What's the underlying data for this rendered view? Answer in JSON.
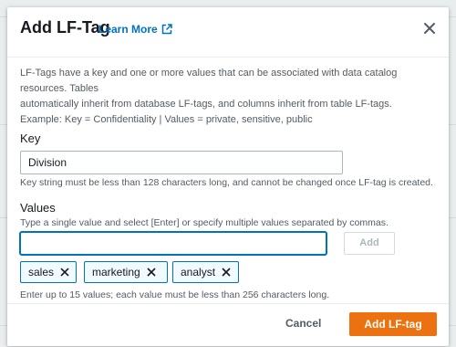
{
  "colors": {
    "primary": "#ec7211",
    "link": "#0073bb",
    "text": "#16191f",
    "muted": "#545b64"
  },
  "modal": {
    "title": "Add LF-Tag",
    "learn_more": "Learn More",
    "learn_more_icon": "external-link-icon",
    "close_icon": "close-icon"
  },
  "description": {
    "line1": "LF-Tags have a key and one or more values that can be associated with data catalog resources. Tables",
    "line2": "automatically inherit from database LF-tags, and columns inherit from table LF-tags.",
    "example": "Example: Key = Confidentiality | Values = private, sensitive, public"
  },
  "key": {
    "label": "Key",
    "value": "Division",
    "hint": "Key string must be less than 128 characters long, and cannot be changed once LF-tag is created."
  },
  "values": {
    "label": "Values",
    "description": "Type a single value and select [Enter] or specify multiple values separated by commas.",
    "input_value": "",
    "add_label": "Add",
    "tags": [
      "sales",
      "marketing",
      "analyst"
    ],
    "limit_hint": "Enter up to 15 values; each value must be less than 256 characters long."
  },
  "footer": {
    "cancel_label": "Cancel",
    "submit_label": "Add LF-tag"
  }
}
